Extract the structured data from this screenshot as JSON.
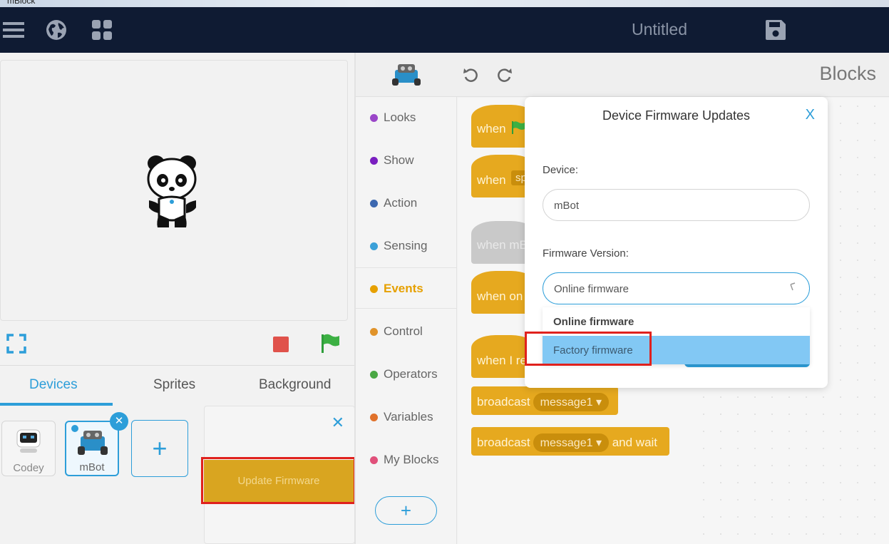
{
  "window": {
    "title": "mBlock"
  },
  "topbar": {
    "project_title": "Untitled"
  },
  "icons": [
    "menu-icon",
    "globe-icon",
    "apps-grid-icon",
    "save-icon",
    "fullscreen-icon",
    "stop-icon",
    "green-flag-icon",
    "undo-icon",
    "redo-icon",
    "mbot-robot-icon",
    "panda-sprite"
  ],
  "tabs": [
    {
      "label": "Devices",
      "active": true
    },
    {
      "label": "Sprites",
      "active": false
    },
    {
      "label": "Background",
      "active": false
    }
  ],
  "devices": [
    {
      "label": "Codey",
      "selected": false
    },
    {
      "label": "mBot",
      "selected": true
    }
  ],
  "add_device": {
    "label": "+"
  },
  "remove_device": {
    "label": "✕"
  },
  "popover": {
    "close_label": "✕",
    "update_button": "Update Firmware"
  },
  "editor": {
    "panel_title": "Blocks"
  },
  "categories": [
    {
      "label": "Looks",
      "color": "#9a46c8"
    },
    {
      "label": "Show",
      "color": "#7a1fc0"
    },
    {
      "label": "Action",
      "color": "#3c68b0"
    },
    {
      "label": "Sensing",
      "color": "#3aa0d8"
    },
    {
      "label": "Events",
      "color": "#e6a000",
      "active": true
    },
    {
      "label": "Control",
      "color": "#e0932a"
    },
    {
      "label": "Operators",
      "color": "#4aa844"
    },
    {
      "label": "Variables",
      "color": "#e0712a"
    },
    {
      "label": "My Blocks",
      "color": "#e0507a"
    }
  ],
  "add_extension": {
    "label": "+"
  },
  "blocks": {
    "b1": "when",
    "b2": "when",
    "b2_arg": "sp",
    "b3": "when mB",
    "b4": "when on",
    "b5": "when I re",
    "broadcast": "broadcast",
    "broadcast_and_wait": "and wait",
    "message": "message1 ▾"
  },
  "modal": {
    "title": "Device Firmware Updates",
    "close_label": "X",
    "device_label": "Device:",
    "device_value": "mBot",
    "version_label": "Firmware Version:",
    "version_value": "Online firmware",
    "options": [
      "Online firmware",
      "Factory firmware"
    ]
  },
  "colors": {
    "accent": "#2d9ed9",
    "topbar": "#0f1b33",
    "events": "#e6a91f",
    "highlight": "#e0211d",
    "option_hover": "#82c8f4"
  }
}
